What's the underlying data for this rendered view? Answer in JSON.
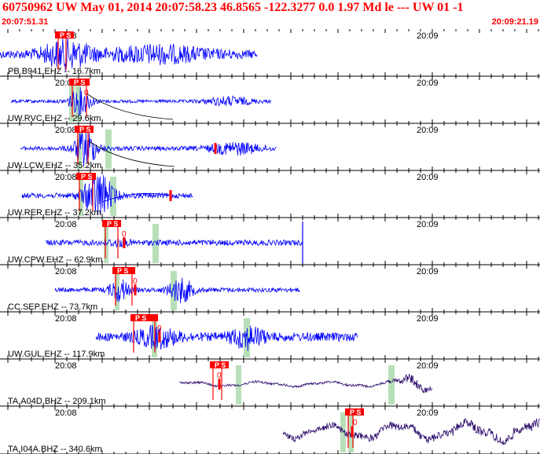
{
  "header": {
    "title": "60750962 UW May 01, 2014 20:07:58.23   46.8565 -122.3277  0.0 1.97 Md le --- UW 01  -1",
    "start_time": "20:07:51.31",
    "end_time": "20:09:21.19"
  },
  "colors": {
    "header_text": "#ff0000",
    "trace_blue": "#0000ff",
    "trace_purple": "#2b0a6b",
    "pick": "#ff0000",
    "window": "#b8e0b8",
    "grid": "#000000"
  },
  "tick_labels": {
    "t2008": "20:08",
    "t2009": "20:09"
  },
  "traces": [
    {
      "label": "PB.B941.EHZ -- 16.7km",
      "pick_text": "P S",
      "zero_text": "",
      "trace_color": "blue"
    },
    {
      "label": "UW.RVC.EHZ -- 29.6km",
      "pick_text": "P S",
      "zero_text": "0",
      "trace_color": "blue"
    },
    {
      "label": "UW.LCW.EHZ -- 35.2km",
      "pick_text": "P S",
      "zero_text": "",
      "trace_color": "blue"
    },
    {
      "label": "UW.RER.EHZ -- 37.2km",
      "pick_text": "P S",
      "zero_text": "",
      "trace_color": "blue"
    },
    {
      "label": "UW.CPW.EHZ -- 62.9km",
      "pick_text": "P S",
      "zero_text": "0",
      "trace_color": "blue"
    },
    {
      "label": "CC.SEP.EHZ -- 73.7km",
      "pick_text": "P S",
      "zero_text": "0",
      "trace_color": "blue"
    },
    {
      "label": "UW.GUL.EHZ -- 117.9km",
      "pick_text": "P S",
      "zero_text": "0",
      "trace_color": "blue"
    },
    {
      "label": "TA.A04D.BHZ -- 209.1km",
      "pick_text": "P S",
      "zero_text": "0",
      "trace_color": "purple"
    },
    {
      "label": "TA.I04A.BHZ -- 340.6km",
      "pick_text": "P S",
      "zero_text": "0",
      "trace_color": "purple"
    }
  ]
}
